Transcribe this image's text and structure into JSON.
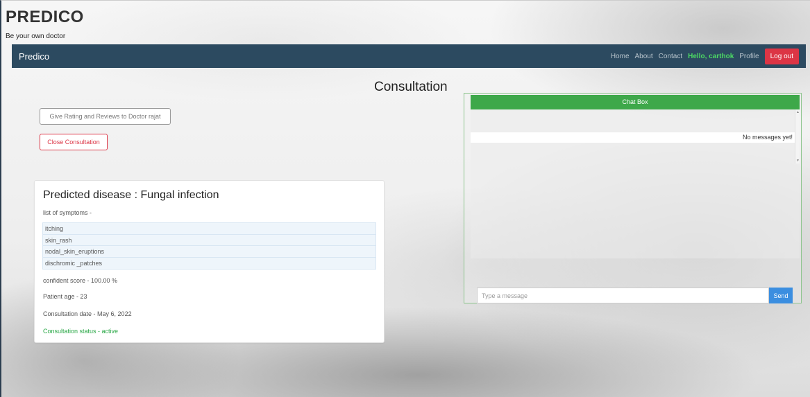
{
  "brand": {
    "title": "PREDICO",
    "tagline": "Be your own doctor"
  },
  "navbar": {
    "brand": "Predico",
    "links": [
      "Home",
      "About",
      "Contact"
    ],
    "greeting": "Hello, carthok",
    "profile": "Profile",
    "logout": "Log out"
  },
  "page": {
    "title": "Consultation"
  },
  "actions": {
    "rate_label": "Give Rating and Reviews to Doctor rajat",
    "close_label": "Close Consultation"
  },
  "prediction": {
    "title": "Predicted disease : Fungal infection",
    "symptoms_label": "list of symptoms -",
    "symptoms": [
      "itching",
      "skin_rash",
      "nodal_skin_eruptions",
      "dischromic _patches"
    ],
    "score": "confident score - 100.00 %",
    "age": "Patient age - 23",
    "date": "Consultation date - May 6, 2022",
    "status": "Consultation status - active"
  },
  "chat": {
    "header": "Chat Box",
    "empty": "No messages yet!",
    "placeholder": "Type a message",
    "send": "Send"
  },
  "colors": {
    "navbar": "#2c4a60",
    "logout": "#dc3545",
    "greeting": "#4cd964",
    "chat_header": "#3ea84a",
    "send": "#3b8ee0",
    "status_active": "#28a745"
  }
}
